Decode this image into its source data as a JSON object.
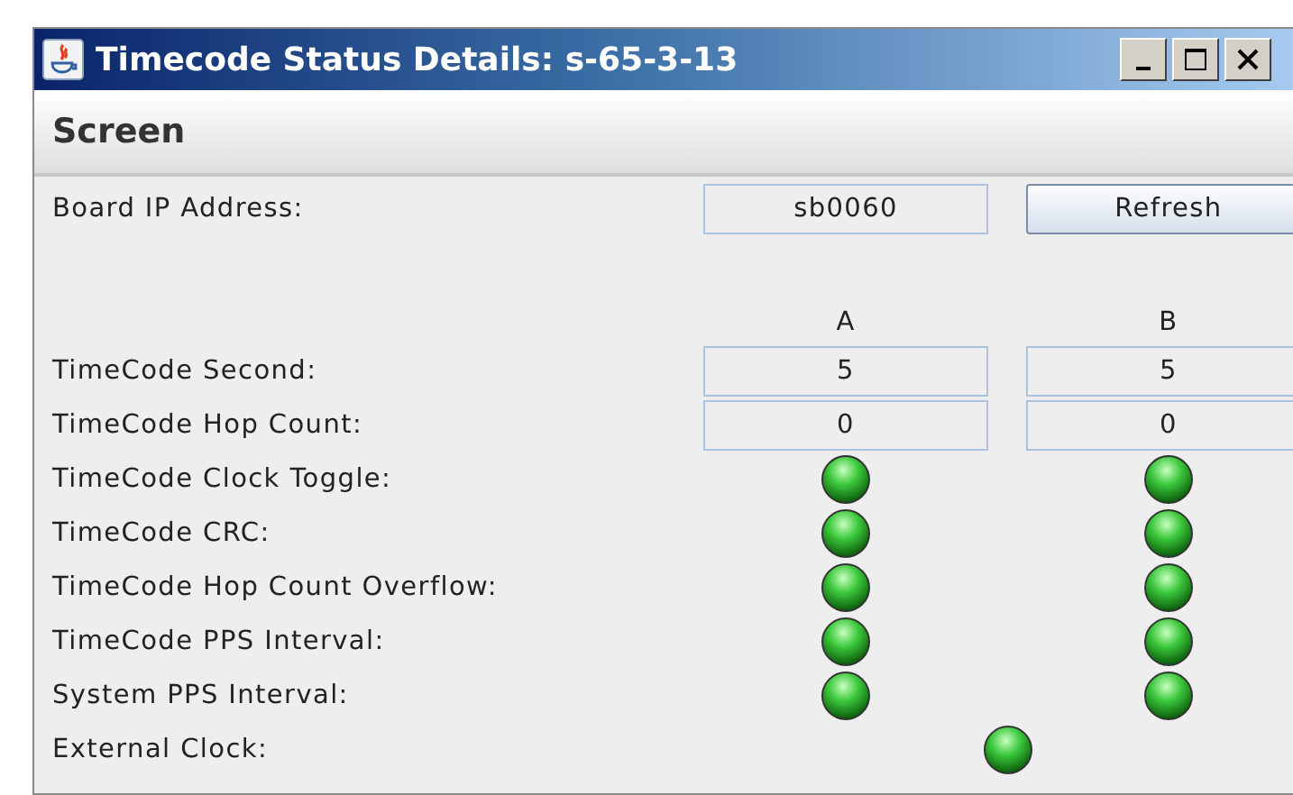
{
  "window": {
    "title": "Timecode Status Details: s-65-3-13"
  },
  "header": "Screen",
  "board_ip": {
    "label": "Board IP Address:",
    "value": "sb0060",
    "button": "Refresh"
  },
  "columns": [
    "A",
    "B"
  ],
  "rows": [
    {
      "kind": "fields",
      "label": "TimeCode Second:",
      "cells": [
        {
          "value": "5"
        },
        {
          "value": "5"
        }
      ]
    },
    {
      "kind": "fields",
      "label": "TimeCode Hop Count:",
      "cells": [
        {
          "value": "0"
        },
        {
          "value": "0"
        }
      ]
    },
    {
      "kind": "leds",
      "label": "TimeCode Clock Toggle:",
      "cells": [
        {
          "on": true
        },
        {
          "on": true
        }
      ]
    },
    {
      "kind": "leds",
      "label": "TimeCode CRC:",
      "cells": [
        {
          "on": true
        },
        {
          "on": true
        }
      ]
    },
    {
      "kind": "leds",
      "label": "TimeCode Hop Count Overflow:",
      "cells": [
        {
          "on": true
        },
        {
          "on": true
        }
      ]
    },
    {
      "kind": "leds",
      "label": "TimeCode PPS Interval:",
      "cells": [
        {
          "on": true
        },
        {
          "on": true
        }
      ]
    },
    {
      "kind": "leds",
      "label": "System PPS Interval:",
      "cells": [
        {
          "on": true
        },
        {
          "on": true
        }
      ]
    },
    {
      "kind": "shared_led",
      "label": "External Clock:",
      "cells": [
        {
          "on": true
        }
      ]
    }
  ]
}
